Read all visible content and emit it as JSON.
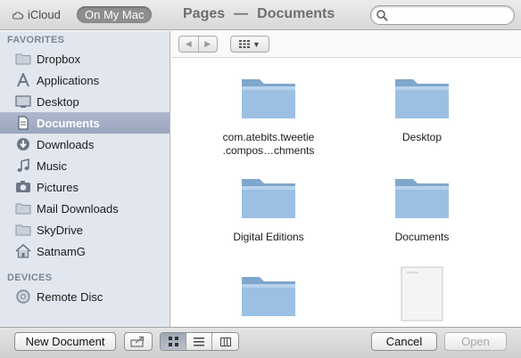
{
  "topbar": {
    "icloud_label": "iCloud",
    "on_my_mac_label": "On My Mac",
    "app_name": "Pages",
    "separator": "—",
    "location": "Documents",
    "search_placeholder": ""
  },
  "sidebar": {
    "favorites_header": "FAVORITES",
    "favorites": [
      {
        "label": "Dropbox",
        "icon": "folder-icon"
      },
      {
        "label": "Applications",
        "icon": "applications-icon"
      },
      {
        "label": "Desktop",
        "icon": "desktop-icon"
      },
      {
        "label": "Documents",
        "icon": "documents-icon",
        "selected": true
      },
      {
        "label": "Downloads",
        "icon": "downloads-icon"
      },
      {
        "label": "Music",
        "icon": "music-icon"
      },
      {
        "label": "Pictures",
        "icon": "pictures-icon"
      },
      {
        "label": "Mail Downloads",
        "icon": "folder-icon"
      },
      {
        "label": "SkyDrive",
        "icon": "folder-icon"
      },
      {
        "label": "SatnamG",
        "icon": "home-icon"
      }
    ],
    "devices_header": "DEVICES",
    "devices": [
      {
        "label": "Remote Disc",
        "icon": "disc-icon"
      }
    ]
  },
  "files": [
    {
      "name_line1": "com.atebits.tweetie",
      "name_line2": ".compos…chments",
      "kind": "folder"
    },
    {
      "name_line1": "Desktop",
      "name_line2": "",
      "kind": "folder"
    },
    {
      "name_line1": "Digital Editions",
      "name_line2": "",
      "kind": "folder"
    },
    {
      "name_line1": "Documents",
      "name_line2": "",
      "kind": "folder"
    },
    {
      "name_line1": "",
      "name_line2": "",
      "kind": "folder"
    },
    {
      "name_line1": "",
      "name_line2": "",
      "kind": "document"
    }
  ],
  "bottombar": {
    "new_document_label": "New Document",
    "cancel_label": "Cancel",
    "open_label": "Open"
  },
  "colors": {
    "sidebar_bg": "#e2e7ef",
    "selected_row": "#9aa5bf",
    "folder_blue": "#8fb3d6"
  }
}
